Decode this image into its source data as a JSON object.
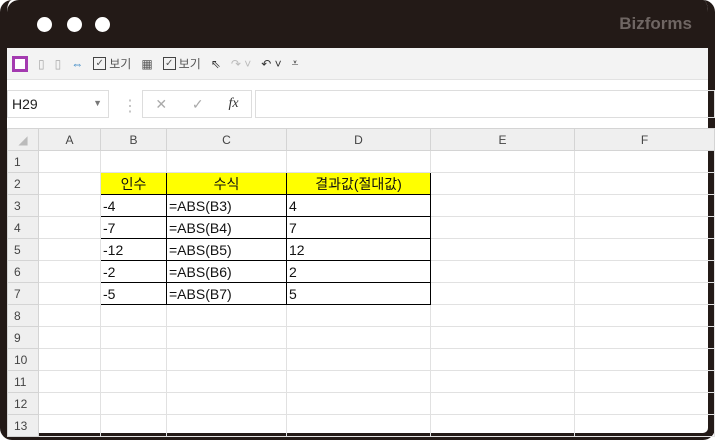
{
  "window": {
    "brand": "Bizforms"
  },
  "toolbar": {
    "view_label_1": "보기",
    "view_label_2": "보기"
  },
  "formula_bar": {
    "name_box": "H29",
    "fx": "fx",
    "cancel": "✕",
    "enter": "✓",
    "value": ""
  },
  "columns": [
    "A",
    "B",
    "C",
    "D",
    "E",
    "F"
  ],
  "rows": [
    "1",
    "2",
    "3",
    "4",
    "5",
    "6",
    "7",
    "8",
    "9",
    "10",
    "11",
    "12",
    "13"
  ],
  "table": {
    "headers": [
      "인수",
      "수식",
      "결과값(절대값)"
    ],
    "data": [
      [
        "-4",
        "=ABS(B3)",
        "4"
      ],
      [
        "-7",
        "=ABS(B4)",
        "7"
      ],
      [
        "-12",
        "=ABS(B5)",
        "12"
      ],
      [
        "-2",
        "=ABS(B6)",
        "2"
      ],
      [
        "-5",
        "=ABS(B7)",
        "5"
      ]
    ]
  }
}
